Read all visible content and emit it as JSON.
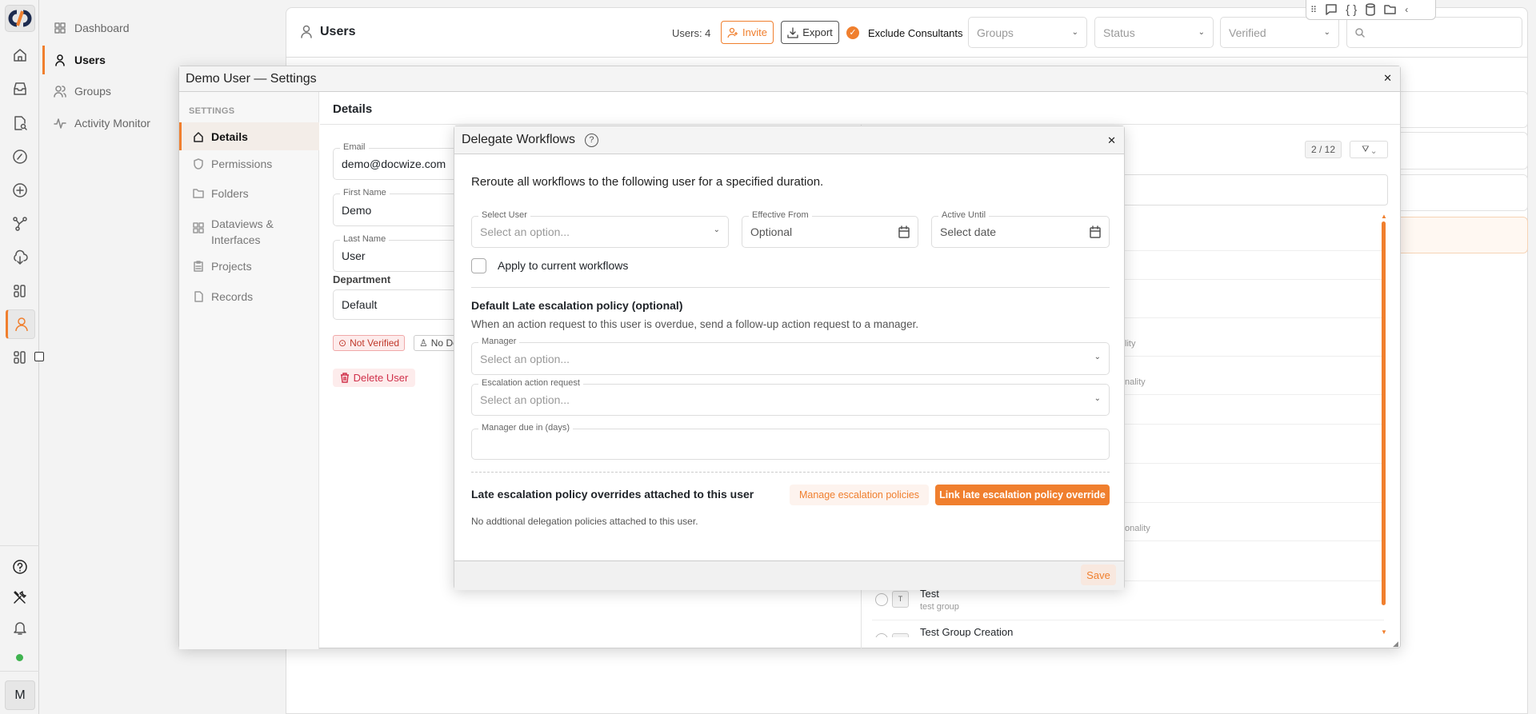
{
  "rail": {
    "items": [
      "home-icon",
      "inbox-icon",
      "document-search-icon",
      "compass-icon",
      "plus-circle-icon",
      "nodes-icon",
      "cloud-download-icon",
      "apps-icon",
      "user-icon",
      "apps-icon"
    ],
    "bottom": [
      "help-icon",
      "tools-icon",
      "bell-icon"
    ],
    "status_color": "#3fb34f",
    "avatar": "M"
  },
  "nav": {
    "items": [
      {
        "label": "Dashboard",
        "icon": "dashboard-icon"
      },
      {
        "label": "Users",
        "icon": "user-icon",
        "active": true
      },
      {
        "label": "Groups",
        "icon": "groups-icon"
      },
      {
        "label": "Activity Monitor",
        "icon": "activity-icon"
      }
    ]
  },
  "header": {
    "title": "Users",
    "count": "Users: 4",
    "invite": "Invite",
    "export": "Export",
    "exclude_consultants": "Exclude Consultants",
    "exclude_checked": true,
    "groups_placeholder": "Groups",
    "status_placeholder": "Status",
    "verified_placeholder": "Verified"
  },
  "accent": "#f07f2e",
  "settings": {
    "title": "Demo User — Settings",
    "section": "SETTINGS",
    "items": [
      "Details",
      "Permissions",
      "Folders",
      "Dataviews & Interfaces",
      "Projects",
      "Records"
    ],
    "active": "Details",
    "content_title": "Details",
    "email_label": "Email",
    "email": "demo@docwize.com",
    "first_label": "First Name",
    "first": "Demo",
    "last_label": "Last Name",
    "last": "User",
    "dept_label": "Department",
    "dept": "Default",
    "badge_verified": "Not Verified",
    "badge_dept": "No De",
    "delete": "Delete User",
    "list": {
      "count": "2 / 12",
      "fragments": [
        "lity",
        "nality",
        "onality"
      ],
      "items": [
        {
          "title": "Test",
          "subtitle": "test group",
          "avatar": "T"
        },
        {
          "title": "Test Group Creation"
        }
      ]
    }
  },
  "delegate": {
    "title": "Delegate Workflows",
    "description": "Reroute all workflows to the following user for a specified duration.",
    "select_user_label": "Select User",
    "select_user_placeholder": "Select an option...",
    "from_label": "Effective From",
    "from_placeholder": "Optional",
    "until_label": "Active Until",
    "until_placeholder": "Select date",
    "apply_label": "Apply to current workflows",
    "apply_checked": false,
    "policy_heading": "Default Late escalation policy (optional)",
    "policy_desc": "When an action request to this user is overdue, send a follow-up action request to a manager.",
    "manager_label": "Manager",
    "manager_placeholder": "Select an option...",
    "escalation_label": "Escalation action request",
    "escalation_placeholder": "Select an option...",
    "due_label": "Manager due in (days)",
    "due_value": "",
    "overrides_heading": "Late escalation policy overrides attached to this user",
    "manage_button": "Manage escalation policies",
    "link_button": "Link late escalation policy override",
    "note": "No addtional delegation policies attached to this user.",
    "save": "Save"
  }
}
